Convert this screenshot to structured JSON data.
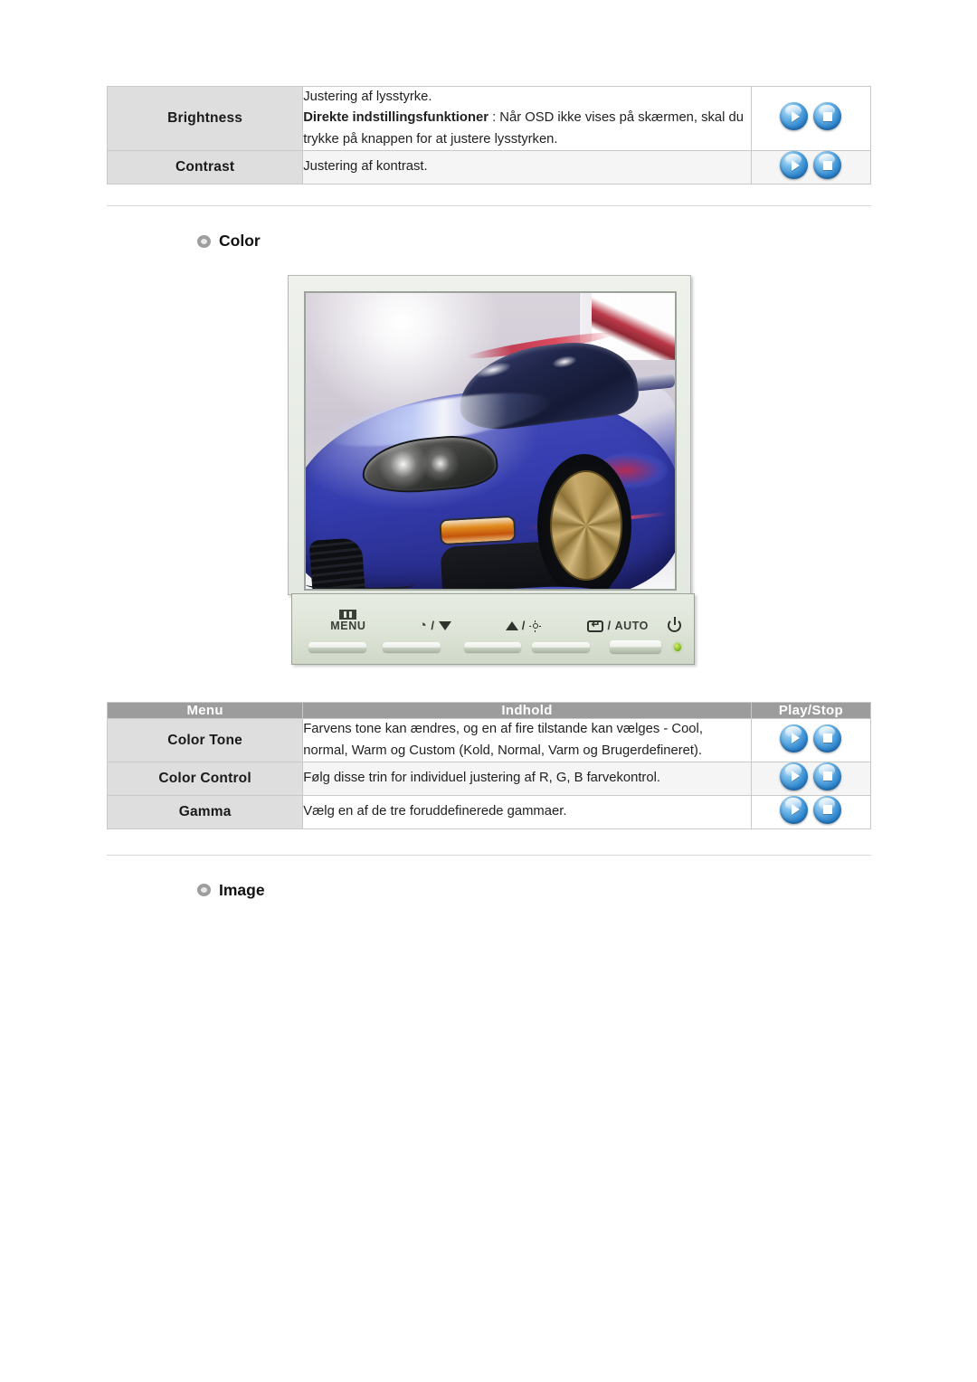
{
  "top_table": {
    "rows": [
      {
        "menu": "Brightness",
        "content_line1": "Justering af lysstyrke.",
        "content_bold": "Direkte indstillingsfunktioner",
        "content_line2": " : Når OSD ikke vises på skærmen, skal du trykke på knappen for at justere lysstyrken.",
        "play_label": "Play",
        "stop_label": "Stop"
      },
      {
        "menu": "Contrast",
        "content_line1": "Justering af kontrast.",
        "play_label": "Play",
        "stop_label": "Stop"
      }
    ]
  },
  "color_section": {
    "heading": "Color",
    "bullet_icon": "ring-bullet-icon"
  },
  "monitor": {
    "screen_alt": "Blå sportsvogn på skærmen",
    "controls": [
      {
        "name": "menu-button",
        "icon": "menu-icon",
        "label": "MENU"
      },
      {
        "name": "down-button",
        "icon": "contrast-down-icon",
        "label": ""
      },
      {
        "name": "up-button",
        "icon": "brightness-up-icon",
        "label": ""
      },
      {
        "name": "source-auto-button",
        "icon": "source-icon",
        "label": "AUTO"
      },
      {
        "name": "power-button",
        "icon": "power-icon",
        "label": ""
      }
    ],
    "auto_label": "AUTO",
    "menu_label": "MENU",
    "led_name": "power-led"
  },
  "color_table": {
    "headers": {
      "menu": "Menu",
      "content": "Indhold",
      "play_stop": "Play/Stop"
    },
    "rows": [
      {
        "menu": "Color Tone",
        "content": "Farvens tone kan ændres, og en af fire tilstande kan vælges - Cool, normal, Warm og Custom (Kold, Normal, Varm og Brugerdefineret).",
        "play_label": "Play",
        "stop_label": "Stop"
      },
      {
        "menu": "Color Control",
        "content": "Følg disse trin for individuel justering af R, G, B farvekontrol.",
        "play_label": "Play",
        "stop_label": "Stop"
      },
      {
        "menu": "Gamma",
        "content": "Vælg en af de tre foruddefinerede gammaer.",
        "play_label": "Play",
        "stop_label": "Stop"
      }
    ]
  },
  "image_section": {
    "heading": "Image",
    "bullet_icon": "ring-bullet-icon"
  },
  "colors": {
    "header_gray": "#9c9c9c",
    "menu_cell_gray": "#dedede",
    "alt_row_gray": "#f5f5f5",
    "button_blue": "#2f86cd",
    "led_green": "#8ac22a",
    "bezel": "#e3e8e0"
  }
}
